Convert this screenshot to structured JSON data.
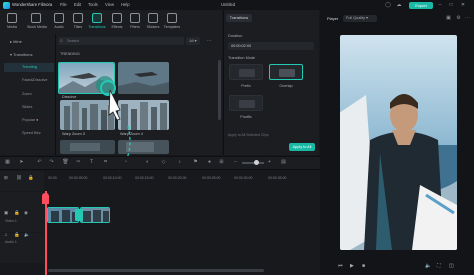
{
  "titlebar": {
    "app_name": "Wondershare Filmora",
    "menus": [
      "File",
      "Edit",
      "Tools",
      "View",
      "Help"
    ],
    "document": "Untitled",
    "export_label": "Export"
  },
  "toolbar": {
    "items": [
      {
        "label": "Media",
        "icon": "media-icon"
      },
      {
        "label": "Stock Media",
        "icon": "stock-media-icon"
      },
      {
        "label": "Audio",
        "icon": "audio-icon"
      },
      {
        "label": "Titles",
        "icon": "titles-icon"
      },
      {
        "label": "Transitions",
        "icon": "transitions-icon",
        "active": true
      },
      {
        "label": "Effects",
        "icon": "effects-icon"
      },
      {
        "label": "Filters",
        "icon": "filters-icon"
      },
      {
        "label": "Stickers",
        "icon": "stickers-icon"
      },
      {
        "label": "Templates",
        "icon": "templates-icon"
      }
    ]
  },
  "leftnav": {
    "items": [
      {
        "label": "Mine",
        "level": 0
      },
      {
        "label": "Transitions",
        "level": 0
      },
      {
        "label": "Trending",
        "level": 1,
        "active": true
      },
      {
        "label": "Fade&Dissolve",
        "level": 1
      },
      {
        "label": "Zoom",
        "level": 1
      },
      {
        "label": "Slides",
        "level": 1
      },
      {
        "label": "Popular",
        "level": 1
      },
      {
        "label": "Speed Blur",
        "level": 1
      }
    ]
  },
  "grid": {
    "search_placeholder": "Search",
    "filter_label": "All",
    "section_label": "TRENDING",
    "items": [
      {
        "label": "Dissolve"
      },
      {
        "label": ""
      },
      {
        "label": "Warp Zoom 3"
      },
      {
        "label": "Warp Zoom 4"
      },
      {
        "label": ""
      },
      {
        "label": ""
      }
    ]
  },
  "props": {
    "tab": "Transitions",
    "duration_label": "Duration",
    "duration_value": "00:00:02:00",
    "mode_label": "Transition Mode",
    "modes": [
      {
        "label": "Prefix"
      },
      {
        "label": "Overlap",
        "selected": true
      },
      {
        "label": "Postfix"
      }
    ],
    "apply_check_label": "Apply to All Selected Clips",
    "apply_label": "Apply to All"
  },
  "player": {
    "tab": "Player",
    "quality": "Full Quality"
  },
  "timeline": {
    "times": [
      "00:00",
      "00:00:05:00",
      "00:00:10:00",
      "00:00:15:00",
      "00:00:20:00",
      "00:00:25:00",
      "00:00:30:00",
      "00:00:35:00"
    ],
    "tracks": [
      {
        "label": "Video 1"
      },
      {
        "label": "Audio 1"
      }
    ]
  },
  "colors": {
    "accent": "#24c9b4",
    "playhead": "#ff4d5e",
    "export": "#19b9a6"
  }
}
